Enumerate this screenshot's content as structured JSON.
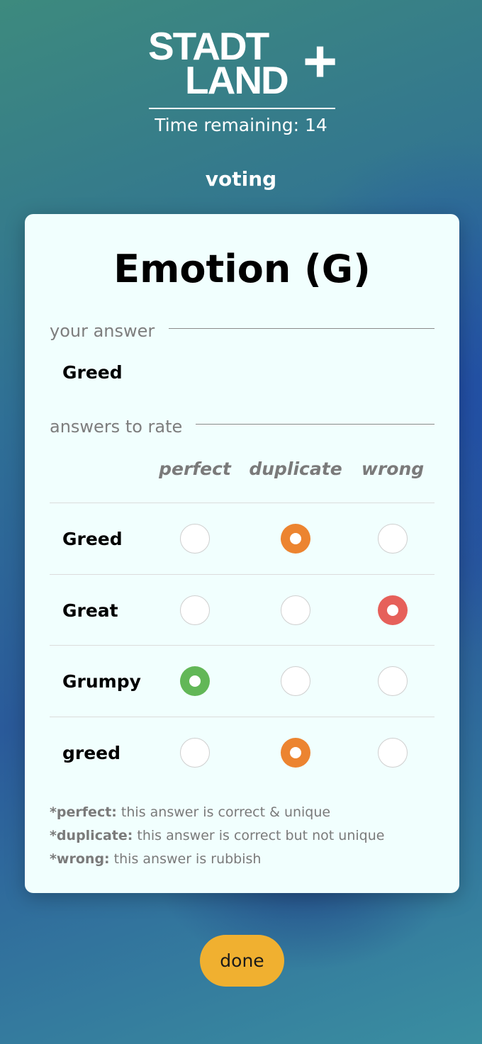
{
  "logo": {
    "line1": "STADT",
    "line2": "LAND",
    "plus": "+"
  },
  "timer": {
    "text": "Time remaining: 14"
  },
  "phase": "voting",
  "card": {
    "category": "Emotion (G)",
    "your_answer_label": "your answer",
    "your_answer": "Greed",
    "rate_label": "answers to rate",
    "columns": [
      "perfect",
      "duplicate",
      "wrong"
    ],
    "rows": [
      {
        "word": "Greed",
        "selected": "duplicate"
      },
      {
        "word": "Great",
        "selected": "wrong"
      },
      {
        "word": "Grumpy",
        "selected": "perfect"
      },
      {
        "word": "greed",
        "selected": "duplicate"
      }
    ],
    "legend": [
      {
        "term": "*perfect:",
        "desc": " this answer is correct & unique"
      },
      {
        "term": "*duplicate:",
        "desc": " this answer is correct but not unique"
      },
      {
        "term": "*wrong:",
        "desc": " this answer is rubbish"
      }
    ]
  },
  "colors": {
    "perfect": "#62b757",
    "duplicate": "#ec8430",
    "wrong": "#e6605a",
    "done_button": "#f0b030"
  },
  "done_label": "done"
}
